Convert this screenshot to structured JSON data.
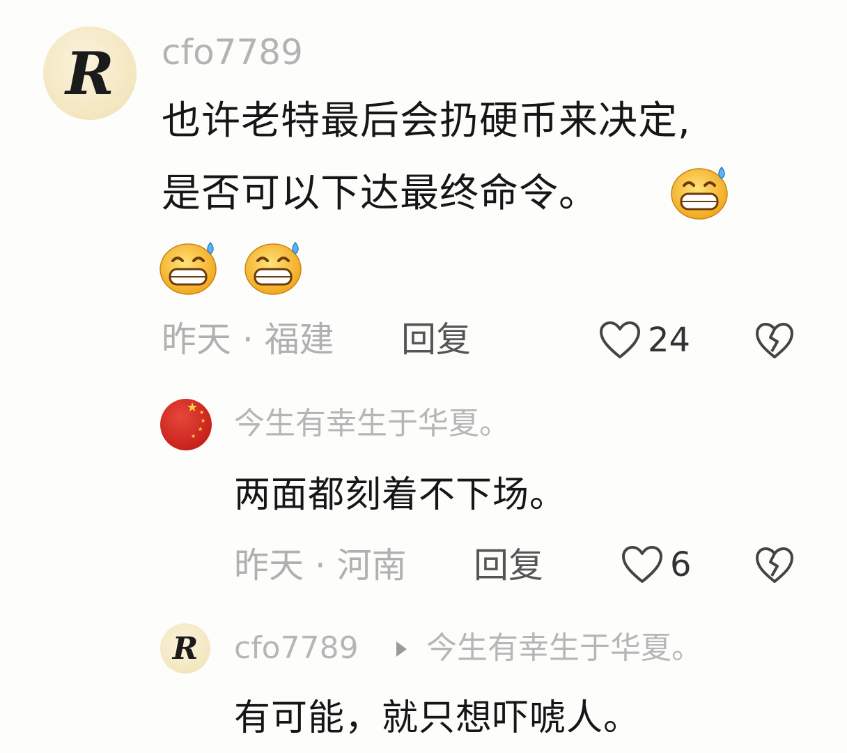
{
  "comments": [
    {
      "user": "cfo7789",
      "avatar_letter": "R",
      "text_line1": "也许老特最后会扔硬币来决定,",
      "text_line2": "是否可以下达最终命令。",
      "emojis": [
        "grinning-sweat-emoji",
        "grinning-sweat-emoji",
        "grinning-sweat-emoji"
      ],
      "meta": "昨天 · 福建",
      "reply_label": "回复",
      "likes": "24",
      "replies": [
        {
          "user": "今生有幸生于华夏。",
          "text": "两面都刻着不下场。",
          "meta": "昨天 · 河南",
          "reply_label": "回复",
          "likes": "6"
        },
        {
          "user": "cfo7789",
          "avatar_letter": "R",
          "reply_to": "今生有幸生于华夏。",
          "text": "有可能，就只想吓唬人。"
        }
      ]
    }
  ]
}
